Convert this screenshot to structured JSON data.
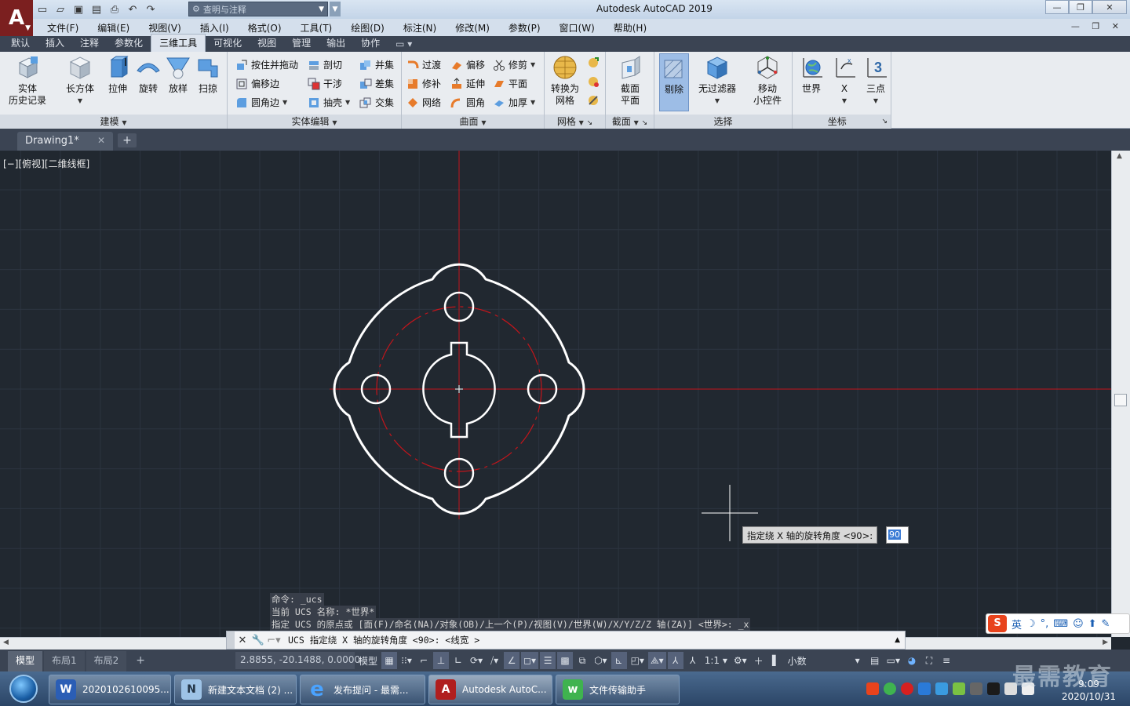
{
  "window": {
    "title": "Autodesk AutoCAD 2019",
    "search_placeholder": "查明与注释"
  },
  "menu": [
    "文件(F)",
    "编辑(E)",
    "视图(V)",
    "插入(I)",
    "格式(O)",
    "工具(T)",
    "绘图(D)",
    "标注(N)",
    "修改(M)",
    "参数(P)",
    "窗口(W)",
    "帮助(H)"
  ],
  "ribbon_tabs": [
    "默认",
    "插入",
    "注释",
    "参数化",
    "三维工具",
    "可视化",
    "视图",
    "管理",
    "输出",
    "协作"
  ],
  "ribbon_active_tab": "三维工具",
  "panels": {
    "modeling": {
      "title": "建模",
      "buttons": [
        "实体\n历史记录",
        "长方体",
        "拉伸",
        "旋转",
        "放样",
        "扫掠"
      ]
    },
    "solid_edit": {
      "title": "实体编辑",
      "buttons": [
        "按住并拖动",
        "剖切",
        "并集",
        "偏移边",
        "干涉",
        "差集",
        "圆角边",
        "抽壳",
        "交集"
      ]
    },
    "surface": {
      "title": "曲面",
      "buttons": [
        "过渡",
        "偏移",
        "修剪",
        "修补",
        "延伸",
        "平面",
        "网络",
        "圆角",
        "加厚"
      ]
    },
    "mesh": {
      "title": "网格",
      "buttons": [
        "转换为\n网格"
      ]
    },
    "section": {
      "title": "截面",
      "buttons": [
        "截面\n平面"
      ]
    },
    "selection": {
      "title": "选择",
      "buttons": [
        "剔除",
        "无过滤器",
        "移动\n小控件"
      ]
    },
    "coordinates": {
      "title": "坐标",
      "buttons": [
        "世界",
        "X",
        "三点"
      ]
    }
  },
  "document_tab": "Drawing1*",
  "viewport_label": "[−][俯视][二维线框]",
  "command_history": [
    "命令: _ucs",
    "当前 UCS 名称: *世界*",
    "指定 UCS 的原点或 [面(F)/命名(NA)/对象(OB)/上一个(P)/视图(V)/世界(W)/X/Y/Z/Z 轴(ZA)] <世界>: _x"
  ],
  "command_input": "UCS 指定绕 X 轴的旋转角度 <90>:  <线宽 >",
  "dynamic_input": {
    "prompt": "指定绕 X 轴的旋转角度 <90>:",
    "value": "90"
  },
  "ime": {
    "mode": "英"
  },
  "layout_tabs": [
    "模型",
    "布局1",
    "布局2"
  ],
  "status": {
    "coordinates": "2.8855, -20.1488, 0.0000",
    "model_label": "模型",
    "scale": "1:1",
    "units": "小数"
  },
  "taskbar": [
    {
      "label": "2020102610095...",
      "icon": "W"
    },
    {
      "label": "新建文本文档 (2) ...",
      "icon": "N"
    },
    {
      "label": "发布提问 - 最需...",
      "icon": "e"
    },
    {
      "label": "Autodesk AutoC...",
      "icon": "A"
    },
    {
      "label": "文件传输助手",
      "icon": "w"
    }
  ],
  "clock": {
    "time": "9:09",
    "date": "2020/10/31"
  },
  "watermark": "最需教育",
  "colors": {
    "canvas_bg": "#212830",
    "grid_line": "#2c3440",
    "center_line": "#c4151b",
    "geometry": "#ffffff",
    "app_logo": "#7b1f1f",
    "highlight": "#9dbde6"
  }
}
